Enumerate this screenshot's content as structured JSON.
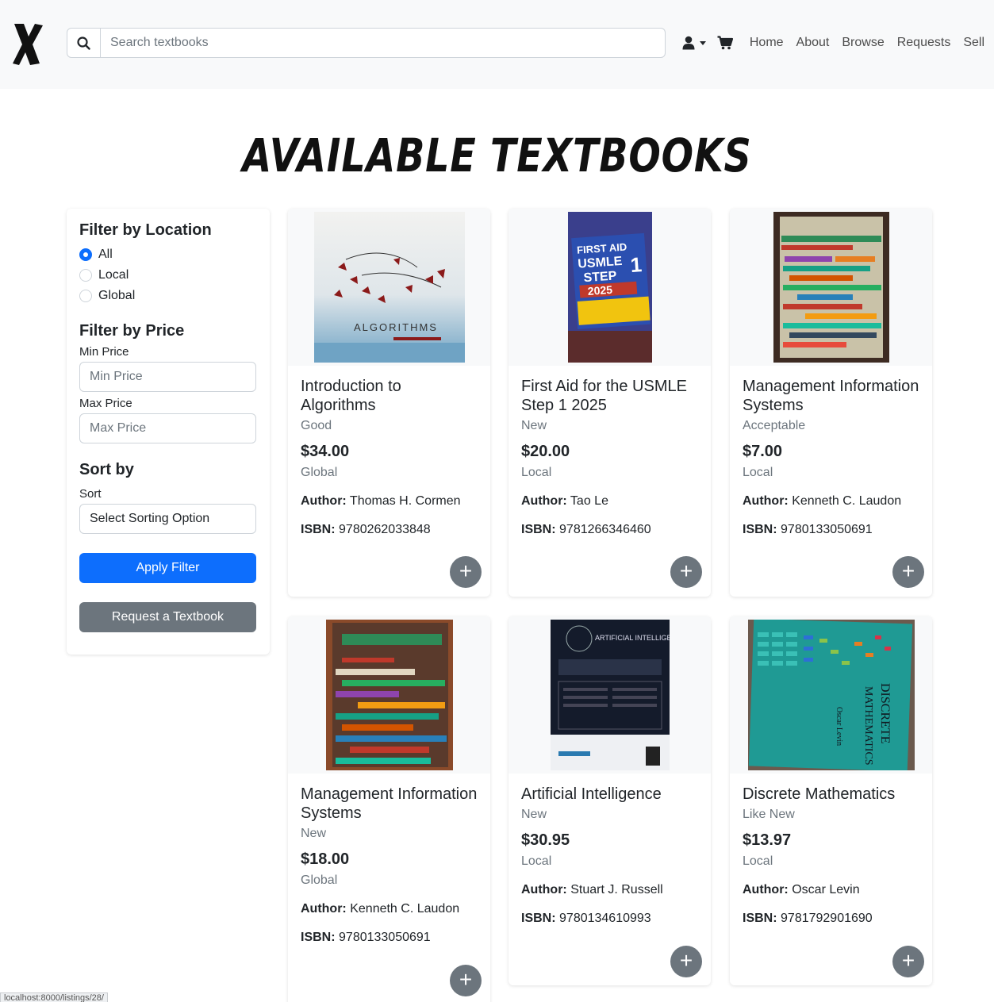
{
  "navbar": {
    "search_placeholder": "Search textbooks",
    "links": [
      "Home",
      "About",
      "Browse",
      "Requests",
      "Sell"
    ]
  },
  "page_title": "Available Textbooks",
  "sidebar": {
    "location_heading": "Filter by Location",
    "location_options": [
      "All",
      "Local",
      "Global"
    ],
    "location_selected": "All",
    "price_heading": "Filter by Price",
    "min_label": "Min Price",
    "min_placeholder": "Min Price",
    "max_label": "Max Price",
    "max_placeholder": "Max Price",
    "sort_heading": "Sort by",
    "sort_label": "Sort",
    "sort_value": "Select Sorting Option",
    "apply_label": "Apply Filter",
    "request_label": "Request a Textbook"
  },
  "listings": [
    {
      "title": "Introduction to Algorithms",
      "condition": "Good",
      "price": "$34.00",
      "location": "Global",
      "author_label": "Author:",
      "author": "Thomas H. Cormen",
      "isbn_label": "ISBN:",
      "isbn": "9780262033848",
      "add": "+"
    },
    {
      "title": "First Aid for the USMLE Step 1 2025",
      "condition": "New",
      "price": "$20.00",
      "location": "Local",
      "author_label": "Author:",
      "author": "Tao Le",
      "isbn_label": "ISBN:",
      "isbn": "9781266346460",
      "add": "+"
    },
    {
      "title": "Management Information Systems",
      "condition": "Acceptable",
      "price": "$7.00",
      "location": "Local",
      "author_label": "Author:",
      "author": "Kenneth C. Laudon",
      "isbn_label": "ISBN:",
      "isbn": "9780133050691",
      "add": "+"
    },
    {
      "title": "Management Information Systems",
      "condition": "New",
      "price": "$18.00",
      "location": "Global",
      "author_label": "Author:",
      "author": "Kenneth C. Laudon",
      "isbn_label": "ISBN:",
      "isbn": "9780133050691",
      "add": "+"
    },
    {
      "title": "Artificial Intelligence",
      "condition": "New",
      "price": "$30.95",
      "location": "Local",
      "author_label": "Author:",
      "author": "Stuart J. Russell",
      "isbn_label": "ISBN:",
      "isbn": "9780134610993",
      "add": "+"
    },
    {
      "title": "Discrete Mathematics",
      "condition": "Like New",
      "price": "$13.97",
      "location": "Local",
      "author_label": "Author:",
      "author": "Oscar Levin",
      "isbn_label": "ISBN:",
      "isbn": "9781792901690",
      "add": "+"
    }
  ],
  "status_url": "localhost:8000/listings/28/",
  "colors": {
    "primary": "#0d6efd",
    "secondary": "#6c757d",
    "navbar_bg": "#f8f9fa"
  }
}
